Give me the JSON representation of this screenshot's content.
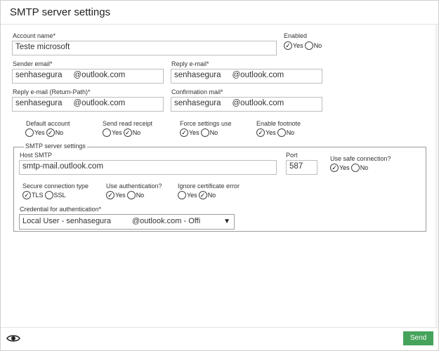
{
  "window": {
    "title": "SMTP server settings"
  },
  "account": {
    "label": "Account name*",
    "value": "Teste microsoft"
  },
  "enabled": {
    "label": "Enabled",
    "yes": "Yes",
    "no": "No",
    "selected": "yes"
  },
  "sender_email": {
    "label": "Sender email*",
    "user": "senhasegura",
    "domain": "@outlook.com"
  },
  "reply_email": {
    "label": "Reply e-mail*",
    "user": "senhasegura",
    "domain": "@outlook.com"
  },
  "return_path": {
    "label": "Reply e-mail (Return-Path)*",
    "user": "senhasegura",
    "domain": "@outlook.com"
  },
  "confirmation_mail": {
    "label": "Confirmation mail*",
    "user": "senhasegura",
    "domain": "@outlook.com"
  },
  "options": [
    {
      "label": "Default account",
      "yes": "Yes",
      "no": "No",
      "selected": "no"
    },
    {
      "label": "Send read receipt",
      "yes": "Yes",
      "no": "No",
      "selected": "no"
    },
    {
      "label": "Force settings use",
      "yes": "Yes",
      "no": "No",
      "selected": "yes"
    },
    {
      "label": "Enable footnote",
      "yes": "Yes",
      "no": "No",
      "selected": "yes"
    }
  ],
  "smtp": {
    "legend": "SMTP server settings",
    "host_label": "Host SMTP",
    "host_value": "smtp-mail.outlook.com",
    "port_label": "Port",
    "port_value": "587",
    "safe_label": "Use safe connection?",
    "safe_yes": "Yes",
    "safe_no": "No",
    "safe_selected": "yes",
    "secure_type_label": "Secure connection type",
    "tls": "TLS",
    "ssl": "SSL",
    "secure_selected": "tls",
    "auth_label": "Use authentication?",
    "auth_yes": "Yes",
    "auth_no": "No",
    "auth_selected": "yes",
    "cert_label": "Ignore certificate error",
    "cert_yes": "Yes",
    "cert_no": "No",
    "cert_selected": "no",
    "credential_label": "Credential for authentication*",
    "credential_left": "Local User - senhasegura",
    "credential_right": "@outlook.com - Offi"
  },
  "footer": {
    "send_label": "Send",
    "eye_icon": "eye-icon"
  }
}
